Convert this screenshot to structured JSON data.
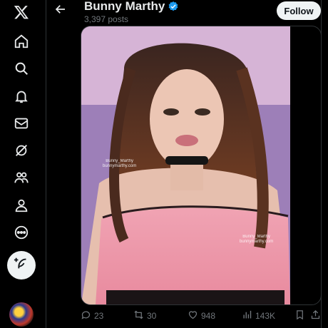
{
  "sidebar": {
    "items": [
      {
        "icon": "x-logo-icon"
      },
      {
        "icon": "home-icon"
      },
      {
        "icon": "search-icon"
      },
      {
        "icon": "bell-icon"
      },
      {
        "icon": "mail-icon"
      },
      {
        "icon": "grok-icon"
      },
      {
        "icon": "communities-icon"
      },
      {
        "icon": "profile-icon"
      },
      {
        "icon": "more-icon"
      }
    ],
    "compose_icon": "feather-plus-icon"
  },
  "header": {
    "name": "Bunny Marthy",
    "post_count": "3,397 posts",
    "follow_label": "Follow"
  },
  "media": {
    "watermark_handle": "Bunny_Marthy",
    "watermark_site": "bunnymarthy.com"
  },
  "actions": {
    "replies": "23",
    "reposts": "30",
    "likes": "948",
    "views": "143K"
  },
  "colors": {
    "background": "#000000",
    "text": "#e7e9ea",
    "muted": "#71767b",
    "verified": "#1d9bf0",
    "button_bg": "#eff3f4"
  }
}
